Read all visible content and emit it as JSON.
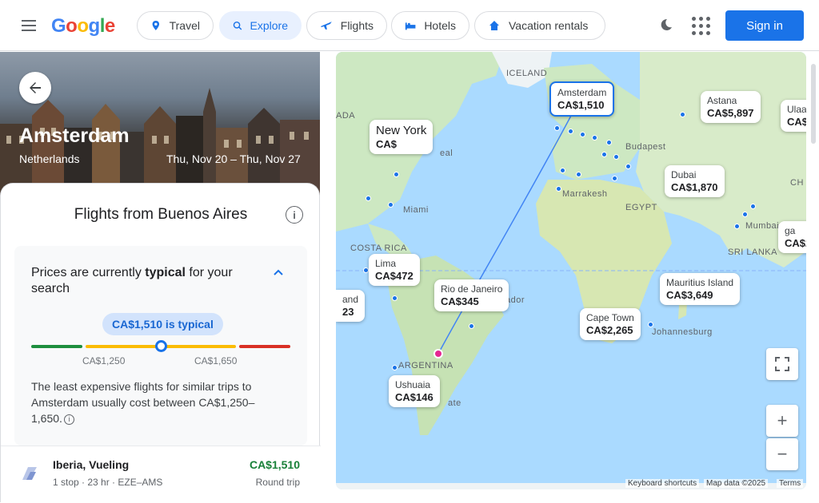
{
  "header": {
    "logo": [
      "G",
      "o",
      "o",
      "g",
      "l",
      "e"
    ],
    "logo_colors": [
      "#4285f4",
      "#ea4335",
      "#fbbc05",
      "#4285f4",
      "#34a853",
      "#ea4335"
    ],
    "nav": [
      {
        "label": "Travel",
        "icon": "travel-icon"
      },
      {
        "label": "Explore",
        "icon": "explore-icon"
      },
      {
        "label": "Flights",
        "icon": "flights-icon"
      },
      {
        "label": "Hotels",
        "icon": "hotels-icon"
      },
      {
        "label": "Vacation rentals",
        "icon": "vacation-rentals-icon"
      }
    ],
    "sign_in": "Sign in"
  },
  "destination": {
    "city": "Amsterdam",
    "country": "Netherlands",
    "dates": "Thu, Nov 20 – Thu, Nov 27"
  },
  "panel": {
    "title": "Flights from Buenos Aires",
    "insight_prefix": "Prices are currently ",
    "insight_level": "typical",
    "insight_suffix": " for your search",
    "badge": "CA$1,510 is typical",
    "range_low": "CA$1,250",
    "range_high": "CA$1,650",
    "price_position": 0.5,
    "least_text": "The least expensive flights for similar trips to Amsterdam usually cost between CA$1,250–1,650.",
    "colors": {
      "low": "#1e8e3e",
      "typical": "#fbbc04",
      "high": "#d93025",
      "accent": "#1a73e8"
    }
  },
  "flight": {
    "airline": "Iberia, Vueling",
    "meta": "1 stop · 23 hr · EZE–AMS",
    "price": "CA$1,510",
    "trip_type": "Round trip"
  },
  "map": {
    "labels": {
      "iceland": "ICELAND",
      "canada": "ADA",
      "montreal": "eal",
      "budapest": "Budapest",
      "miami": "Miami",
      "marrakesh": "Marrakesh",
      "egypt": "EGYPT",
      "china": "CH",
      "mumbai": "Mumbai",
      "srilanka": "SRI LANKA",
      "costarica": "COSTA RICA",
      "ecuador": "ador",
      "johannesburg": "Johannesburg",
      "argentina": "ARGENTINA",
      "state": "ate",
      "lima_partial": "ima"
    },
    "pins": {
      "amsterdam": {
        "name": "Amsterdam",
        "price": "CA$1,510"
      },
      "new_york": {
        "name": "New York",
        "price": "CA$"
      },
      "astana": {
        "name": "Astana",
        "price": "CA$5,897"
      },
      "ulaan": {
        "name": "Ulaa",
        "price": "CA$"
      },
      "dubai": {
        "name": "Dubai",
        "price": "CA$1,870"
      },
      "lima": {
        "name": "Lima",
        "price": "CA$472"
      },
      "rio": {
        "name": "Rio de Janeiro",
        "price": "CA$345"
      },
      "cape_town": {
        "name": "Cape Town",
        "price": "CA$2,265"
      },
      "mauritius": {
        "name": "Mauritius Island",
        "price": "CA$3,649"
      },
      "ushuaia": {
        "name": "Ushuaia",
        "price": "CA$146"
      },
      "left_partial": {
        "name": "and",
        "price": "23"
      },
      "right_partial": {
        "name": "ga",
        "price": "CA$2"
      }
    },
    "zoom_in": "+",
    "zoom_out": "−",
    "keyboard_shortcuts": "Keyboard shortcuts",
    "map_data": "Map data ©2025",
    "terms": "Terms"
  }
}
